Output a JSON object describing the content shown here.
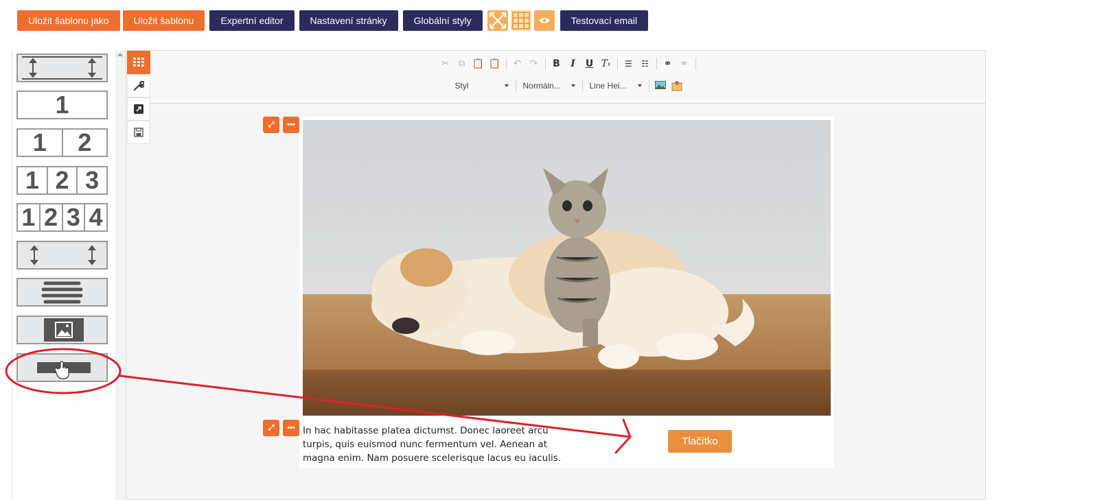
{
  "toolbar": {
    "save_as_label": "Uložit šablonu jako",
    "save_label": "Uložit šablonu",
    "expert_label": "Expertní editor",
    "page_settings_label": "Nastavení stránky",
    "global_styles_label": "Globální styly",
    "test_email_label": "Testovací email",
    "icons": [
      "fullscreen-icon",
      "grid-icon",
      "eye-icon"
    ]
  },
  "blocks": {
    "items": [
      {
        "name": "spacer-block-wide",
        "icon": "vertical-spacer-icon"
      },
      {
        "name": "one-column-block",
        "cols": [
          "1"
        ]
      },
      {
        "name": "two-column-block",
        "cols": [
          "1",
          "2"
        ]
      },
      {
        "name": "three-column-block",
        "cols": [
          "1",
          "2",
          "3"
        ]
      },
      {
        "name": "four-column-block",
        "cols": [
          "1",
          "2",
          "3",
          "4"
        ]
      },
      {
        "name": "spacer-block",
        "icon": "vertical-spacer-icon"
      },
      {
        "name": "text-block",
        "icon": "text-lines-icon"
      },
      {
        "name": "image-block",
        "icon": "image-icon"
      },
      {
        "name": "button-block",
        "icon": "button-hand-icon"
      }
    ]
  },
  "side_tabs": [
    "grid-icon",
    "wrench-icon",
    "external-icon",
    "save-icon"
  ],
  "editor": {
    "row1_buttons": [
      "cut-icon",
      "copy-icon",
      "paste-icon",
      "paste-text-icon",
      "undo-icon",
      "redo-icon",
      "bold-icon",
      "italic-icon",
      "underline-icon",
      "remove-format-icon",
      "numbered-list-icon",
      "bulleted-list-icon",
      "link-icon",
      "unlink-icon"
    ],
    "style_combo": "Styl",
    "format_combo": "Normáln...",
    "lineheight_combo": "Line Hei...",
    "row2_icons": [
      "insert-image-icon",
      "insert-placeholder-icon"
    ]
  },
  "content": {
    "body_text": "In hac habitasse platea dictumst. Donec laoreet arcu turpis, quis euismod nunc fermentum vel. Aenean at magna enim. Nam posuere scelerisque lacus eu iaculis.",
    "button_label": "Tlačítko"
  },
  "colors": {
    "orange": "#ee6e2d",
    "navy": "#2b2b5c",
    "light_orange": "#f6ae5c",
    "cta": "#e8903e",
    "annotation_red": "#d8232a"
  }
}
